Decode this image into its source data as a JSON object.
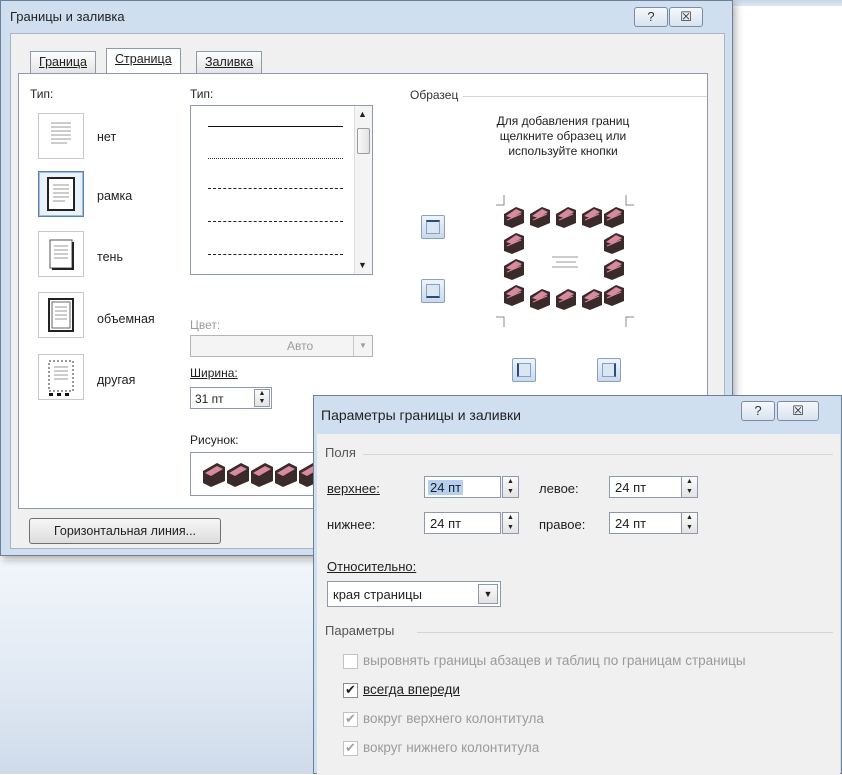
{
  "main_dialog": {
    "title": "Границы и заливка",
    "help_btn": "?",
    "close_btn": "☒",
    "tabs": [
      {
        "label": "Граница"
      },
      {
        "label": "Страница"
      },
      {
        "label": "Заливка"
      }
    ],
    "active_tab": "Страница",
    "type_label": "Тип:",
    "types": [
      {
        "label": "нет"
      },
      {
        "label": "рамка"
      },
      {
        "label": "тень"
      },
      {
        "label": "объемная"
      },
      {
        "label": "другая"
      }
    ],
    "selected_type": "рамка",
    "style_label": "Тип:",
    "color_label": "Цвет:",
    "color_value": "Авто",
    "width_label": "Ширина:",
    "width_value": "31 пт",
    "picture_label": "Рисунок:",
    "sample_label": "Образец",
    "sample_hint": [
      "Для добавления границ",
      "щелкните образец или",
      "используйте кнопки"
    ],
    "horizontal_line_btn": "Горизонтальная линия..."
  },
  "options_dialog": {
    "title": "Параметры границы и заливки",
    "help_btn": "?",
    "close_btn": "☒",
    "margins_group": "Поля",
    "fields": {
      "top_label": "верхнее:",
      "top_value": "24 пт",
      "left_label": "левое:",
      "left_value": "24 пт",
      "bottom_label": "нижнее:",
      "bottom_value": "24 пт",
      "right_label": "правое:",
      "right_value": "24 пт"
    },
    "relative_label": "Относительно:",
    "relative_value": "края страницы",
    "params_group": "Параметры",
    "checkboxes": [
      {
        "label": "выровнять границы абзацев и таблиц по границам страницы",
        "checked": false,
        "enabled": false
      },
      {
        "label": "всегда впереди",
        "checked": true,
        "enabled": true
      },
      {
        "label": "вокруг верхнего колонтитула",
        "checked": true,
        "enabled": false
      },
      {
        "label": "вокруг нижнего колонтитула",
        "checked": true,
        "enabled": false
      }
    ]
  },
  "colors": {
    "title_bar": "#cfdff0",
    "dialog_face": "#f0f0f0",
    "selection": "#b5cff0",
    "cake_dark": "#3a2a2a",
    "cake_pink": "#d88aa0"
  }
}
